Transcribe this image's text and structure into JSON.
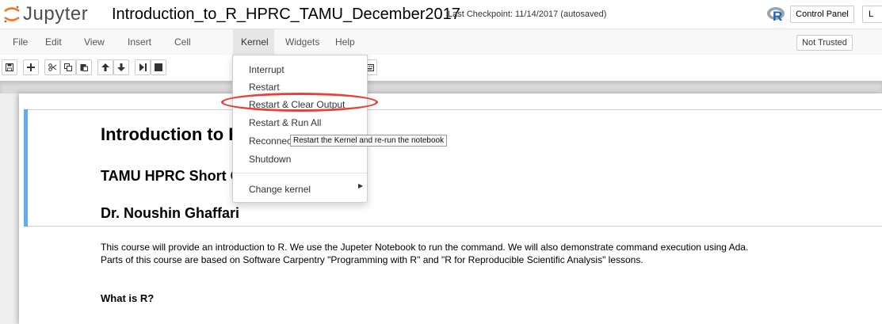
{
  "header": {
    "logo_text": "Jupyter",
    "notebook_name": "Introduction_to_R_HPRC_TAMU_December2017",
    "checkpoint": "Last Checkpoint: 11/14/2017 (autosaved)",
    "control_panel_label": "Control Panel",
    "logout_label": "L"
  },
  "menubar": {
    "items": [
      "File",
      "Edit",
      "View",
      "Insert",
      "Cell",
      "Kernel",
      "Widgets",
      "Help"
    ],
    "trust_label": "Not Trusted"
  },
  "kernel_menu": {
    "items": [
      "Interrupt",
      "Restart",
      "Restart & Clear Output",
      "Restart & Run All",
      "Reconnect",
      "Shutdown",
      "Change kernel"
    ],
    "highlighted_item": "Restart & Clear Output",
    "tooltip": "Restart the Kernel and re-run the notebook"
  },
  "notebook": {
    "heading1": "Introduction to R",
    "heading2": "TAMU HPRC Short Course: Fall 2017",
    "heading3": "Dr. Noushin Ghaffari",
    "paragraph1": "This course will provide an introduction to R. We use the Jupeter Notebook to run the command. We will also demonstrate command execution using Ada.",
    "paragraph2": "Parts of this course are based on Software Carpentry \"Programming with R\" and \"R for Reproducible Scientific Analysis\" lessons.",
    "heading4": "What is R?"
  },
  "colors": {
    "accent_blue": "#66a9ee",
    "highlight_red": "#e8403a",
    "jupyter_orange": "#f37626"
  },
  "icons": [
    "save-icon",
    "plus-icon",
    "cut-icon",
    "copy-icon",
    "paste-icon",
    "arrow-up-icon",
    "arrow-down-icon",
    "run-icon",
    "stop-icon",
    "restart-icon",
    "keyboard-icon"
  ]
}
